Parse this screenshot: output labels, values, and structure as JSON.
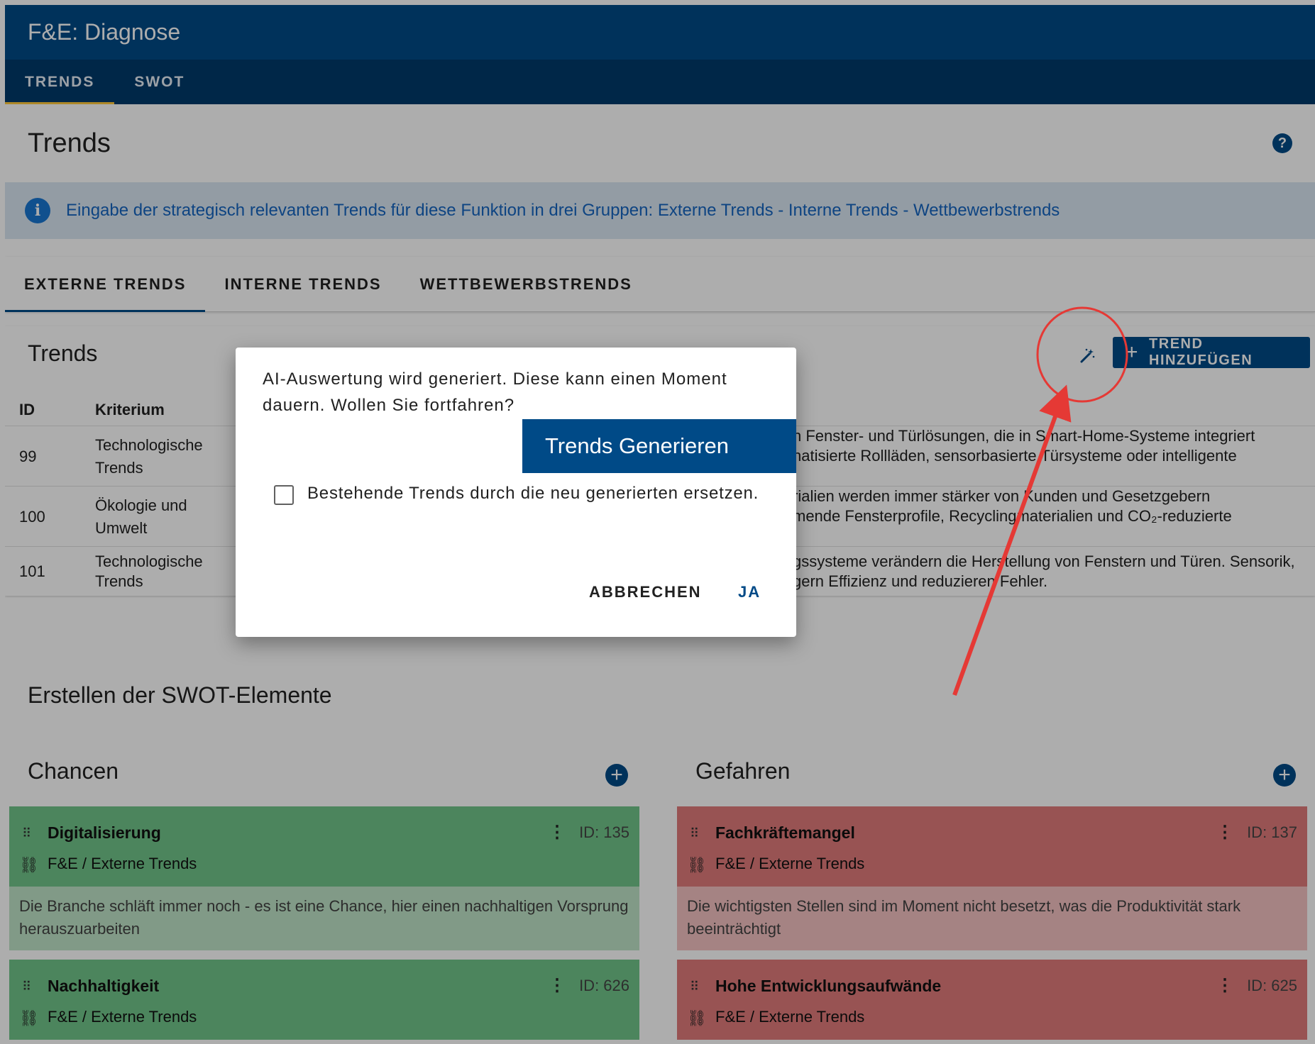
{
  "appbar": {
    "title": "F&E: Diagnose"
  },
  "nav": {
    "tabs": [
      {
        "label": "TRENDS"
      },
      {
        "label": "SWOT"
      }
    ]
  },
  "page": {
    "title": "Trends",
    "help": "?"
  },
  "info": {
    "text": "Eingabe der strategisch relevanten Trends für diese Funktion in drei Gruppen: Externe Trends - Interne Trends - Wettbewerbstrends"
  },
  "subtabs": [
    {
      "label": "EXTERNE TRENDS"
    },
    {
      "label": "INTERNE TRENDS"
    },
    {
      "label": "WETTBEWERBSTRENDS"
    }
  ],
  "trends": {
    "title": "Trends",
    "add_label": "TREND HINZUFÜGEN",
    "columns": {
      "id": "ID",
      "kriterium": "Kriterium"
    },
    "rows": [
      {
        "id": "99",
        "kriterium_1": "Technologische",
        "kriterium_2": "Trends",
        "desc_1": "h Fenster- und Türlösungen, die in Smart-Home-Systeme integriert",
        "desc_2": "natisierte Rollläden, sensorbasierte Türsysteme oder intelligente"
      },
      {
        "id": "100",
        "kriterium_1": "Ökologie und",
        "kriterium_2": "Umwelt",
        "desc_1": "rialien werden immer stärker von Kunden und Gesetzgebern",
        "desc_2": "mende Fensterprofile, Recyclingmaterialien und CO₂-reduzierte"
      },
      {
        "id": "101",
        "kriterium_1": "Technologische",
        "kriterium_2": "Trends",
        "desc_1": "gssysteme verändern die Herstellung von Fenstern und Türen. Sensorik,",
        "desc_2": "gern Effizienz und reduzieren Fehler."
      }
    ]
  },
  "swot": {
    "title": "Erstellen der SWOT-Elemente",
    "chancen": {
      "title": "Chancen",
      "items": [
        {
          "title": "Digitalisierung",
          "id": "ID: 135",
          "link": "F&E / Externe Trends",
          "body": "Die Branche schläft immer noch - es ist eine Chance, hier einen nachhaltigen Vorsprung herauszuarbeiten"
        },
        {
          "title": "Nachhaltigkeit",
          "id": "ID: 626",
          "link": "F&E / Externe Trends"
        }
      ]
    },
    "gefahren": {
      "title": "Gefahren",
      "items": [
        {
          "title": "Fachkräftemangel",
          "id": "ID: 137",
          "link": "F&E / Externe Trends",
          "body": "Die wichtigsten Stellen sind im Moment nicht besetzt, was die Produktivität stark beeinträchtigt"
        },
        {
          "title": "Hohe Entwicklungsaufwände",
          "id": "ID: 625",
          "link": "F&E / Externe Trends"
        }
      ]
    }
  },
  "dialog": {
    "message": "AI-Auswertung wird generiert. Diese kann einen Moment dauern. Wollen Sie fortfahren?",
    "primary": "Trends Generieren",
    "checkbox_label": "Bestehende Trends durch die neu generierten ersetzen.",
    "cancel": "ABBRECHEN",
    "confirm": "JA"
  },
  "colors": {
    "primary": "#004a87",
    "nav": "#003a6b",
    "info_bg": "#d9e6f2",
    "chance": "#70c489",
    "gefahr": "#e07b7b",
    "annotation": "#e53935"
  }
}
